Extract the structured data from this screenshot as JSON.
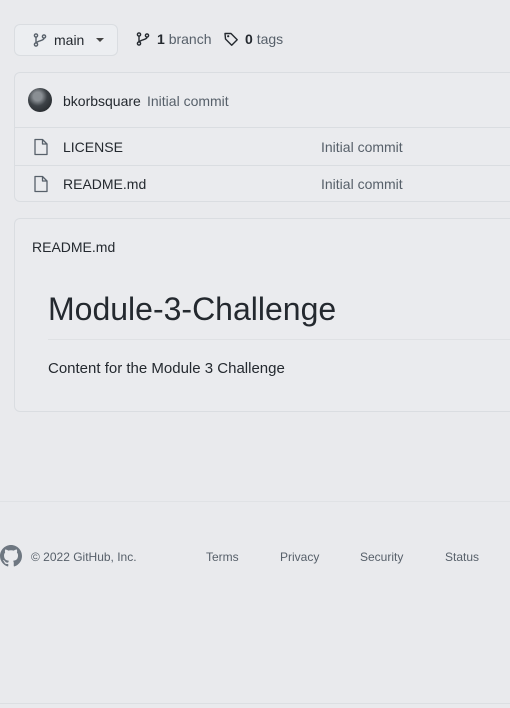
{
  "branch_selector": {
    "label": "main",
    "icon": "git-branch-icon"
  },
  "branches": {
    "count": "1",
    "label": "branch"
  },
  "tags": {
    "count": "0",
    "label": "tags"
  },
  "commit": {
    "author": "bkorbsquare",
    "message": "Initial commit"
  },
  "files": [
    {
      "name": "LICENSE",
      "commit": "Initial commit",
      "icon": "file-icon"
    },
    {
      "name": "README.md",
      "commit": "Initial commit",
      "icon": "file-icon"
    }
  ],
  "readme": {
    "filename": "README.md",
    "heading": "Module-3-Challenge",
    "body": "Content for the Module 3 Challenge"
  },
  "footer": {
    "copyright": "© 2022 GitHub, Inc.",
    "links": [
      "Terms",
      "Privacy",
      "Security",
      "Status"
    ]
  }
}
